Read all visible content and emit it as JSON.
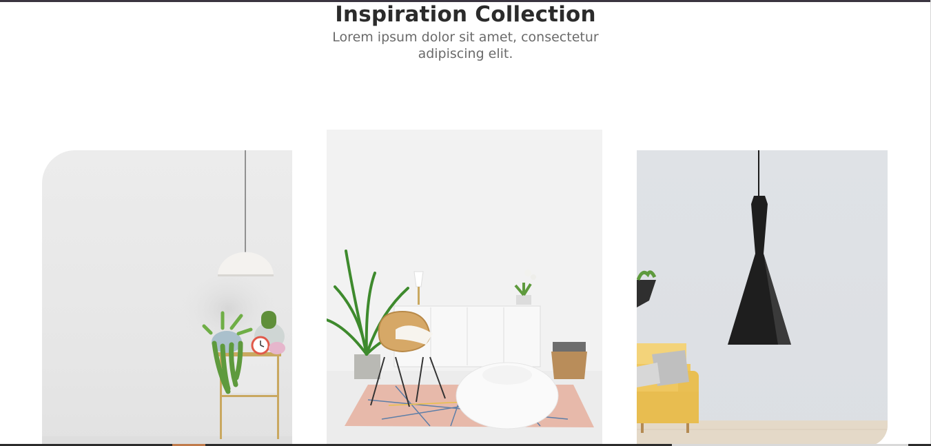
{
  "section": {
    "title": "Inspiration Collection",
    "subtitle": "Lorem ipsum dolor sit amet, consectetur adipiscing elit."
  },
  "cards": [
    {
      "scene": "white-pendant-lamp-plant-stand"
    },
    {
      "scene": "rattan-chair-sideboard-beanbag"
    },
    {
      "scene": "black-pendant-lamp-yellow-sofa"
    }
  ],
  "colors": {
    "title": "#2b2b2b",
    "subtitle": "#6a6a6a",
    "accent": "#c07a4a",
    "top_border": "#3a3540"
  }
}
